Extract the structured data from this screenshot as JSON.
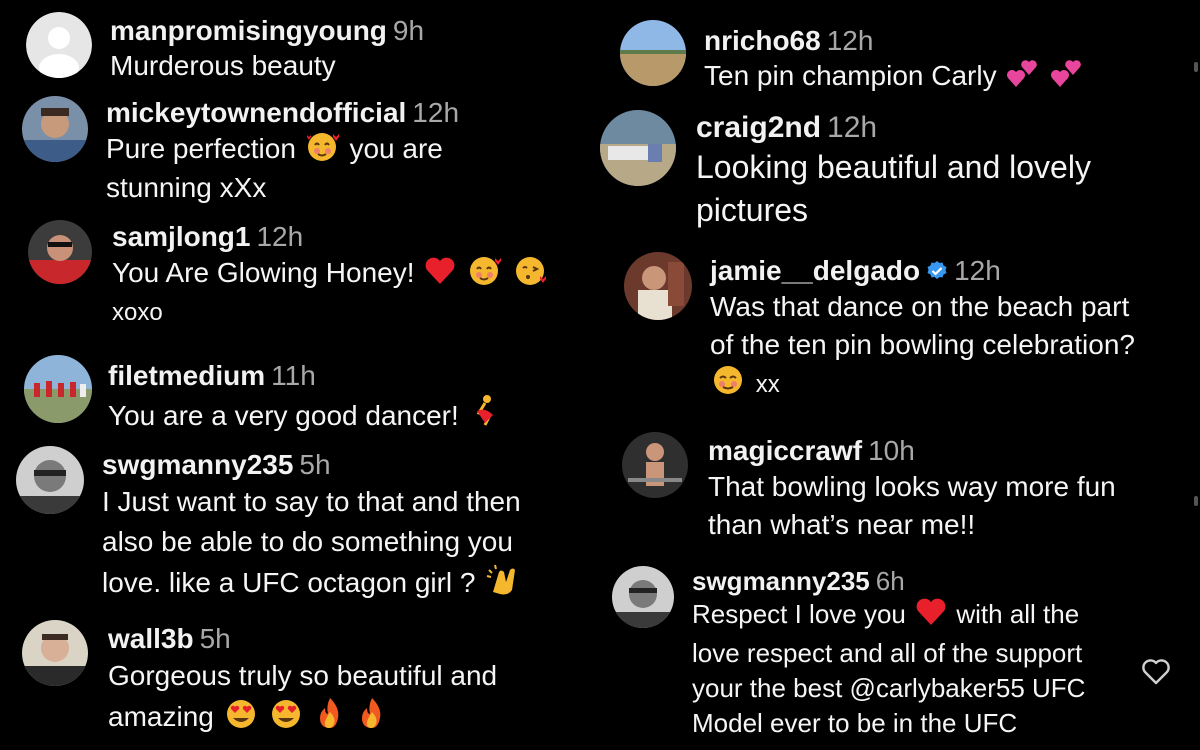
{
  "comments_left": [
    {
      "id": "c1",
      "user": "manpromisingyoung",
      "time": "9h",
      "lines": [
        "Murderous beauty"
      ]
    },
    {
      "id": "c2",
      "user": "mickeytownendofficial",
      "time": "12h",
      "line1_a": "Pure perfection",
      "line1_b": "you are",
      "line2": "stunning xXx"
    },
    {
      "id": "c3",
      "user": "samjlong1",
      "time": "12h",
      "line1": "You Are Glowing Honey!",
      "line2": "xoxo"
    },
    {
      "id": "c4",
      "user": "filetmedium",
      "time": "11h",
      "line1": "You are a very good dancer!"
    },
    {
      "id": "c5",
      "user": "swgmanny235",
      "time": "5h",
      "line1": "I Just want to say to that and then",
      "line2": "also be able to do something you",
      "line3": "love. like a UFC octagon girl ?"
    },
    {
      "id": "c6",
      "user": "wall3b",
      "time": "5h",
      "line1": "Gorgeous truly so beautiful and",
      "line2": "amazing"
    }
  ],
  "comments_right": [
    {
      "id": "r1",
      "user": "nricho68",
      "time": "12h",
      "line1": "Ten pin champion Carly"
    },
    {
      "id": "r2",
      "user": "craig2nd",
      "time": "12h",
      "line1": "Looking beautiful and lovely",
      "line2": "pictures"
    },
    {
      "id": "r3",
      "user": "jamie__delgado",
      "time": "12h",
      "line1": "Was that dance on the beach part",
      "line2": "of the ten pin bowling celebration?",
      "line3": "xx"
    },
    {
      "id": "r4",
      "user": "magiccrawf",
      "time": "10h",
      "line1": "That bowling looks way more fun",
      "line2": "than what’s near me!!"
    },
    {
      "id": "r5",
      "user": "swgmanny235",
      "time": "6h",
      "line1_a": "Respect I love you",
      "line1_b": "with all the",
      "line2": "love respect and all of the support",
      "line3": "your the best @carlybaker55 UFC",
      "line4": "Model ever to be in the UFC"
    }
  ],
  "icons": {
    "like": "heart-outline-icon",
    "verified": "verified-badge-icon"
  },
  "colors": {
    "background": "#000000",
    "text": "#f5f5f5",
    "timestamp": "#a8a8a8",
    "verified": "#3897f0",
    "heart": "#e8202c"
  }
}
